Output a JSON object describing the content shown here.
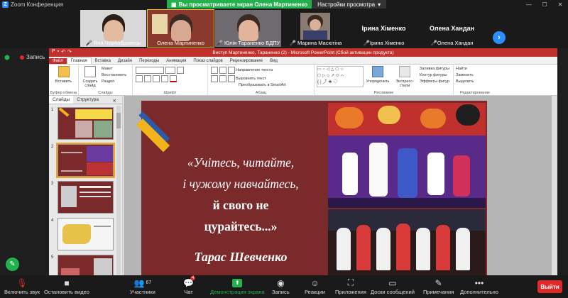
{
  "window": {
    "title": "Zoom Конференция",
    "controls": [
      "—",
      "☐",
      "✕"
    ]
  },
  "viewing": {
    "text": "Вы просматриваете экран Олена Мартиненко",
    "options": "Настройки просмотра",
    "arrow": "▾"
  },
  "participants": [
    {
      "name": "Яна Чорнобривець",
      "muted": true
    },
    {
      "name": "Олена Мартиненко",
      "muted": false
    },
    {
      "name": "Юлія Тараненко БДПУ",
      "muted": true
    },
    {
      "name": "Марина Масютіна",
      "muted": true
    },
    {
      "name": "Ірина Хіменко",
      "muted": true
    },
    {
      "name": "Олена Хандан",
      "muted": true
    }
  ],
  "recording": {
    "label": "Запись"
  },
  "ppt": {
    "title": "Виступ Мартиненко, Тараненко (2) - Microsoft PowerPoint (Сбой активации продукта)",
    "tabs": [
      "Файл",
      "Главная",
      "Вставка",
      "Дизайн",
      "Переходы",
      "Анимация",
      "Показ слайдов",
      "Рецензирование",
      "Вид"
    ],
    "ribbon": {
      "clipboard": "Буфер обмена",
      "slides": "Слайды",
      "font": "Шрифт",
      "paragraph": "Абзац",
      "drawing": "Рисование",
      "editing": "Редактирование",
      "paste": "Вставить",
      "create": "Создать слайд",
      "layout": "Макет",
      "restore": "Восстановить",
      "section": "Раздел",
      "direction": "Направление текста",
      "align": "Выровнять текст",
      "smartart": "Преобразовать в SmartArt",
      "arrange": "Упорядочить",
      "styles": "Экспресс-стили",
      "fill": "Заливка фигуры",
      "outline": "Контур фигуры",
      "effects": "Эффекты фигур",
      "find": "Найти",
      "replace": "Заменить",
      "select": "Выделить"
    },
    "pane_tabs": [
      "Слайды",
      "Структура"
    ],
    "pane_close": "✕",
    "slide_numbers": [
      "1",
      "2",
      "3",
      "4",
      "5"
    ],
    "slide": {
      "quote_lines": [
        "«Учітесь, читайте,",
        "і чужому навчайтесь,",
        "й свого не",
        "цурайтесь...»"
      ],
      "author": "Тарас Шевченко"
    }
  },
  "toolbar": [
    {
      "label": "Включить звук",
      "icon": "mic-muted-icon",
      "glyph": "🎙"
    },
    {
      "label": "Остановить видео",
      "icon": "camera-icon",
      "glyph": "■"
    },
    {
      "label": "Участники",
      "icon": "participants-icon",
      "glyph": "👥",
      "count": "67"
    },
    {
      "label": "Чат",
      "icon": "chat-icon",
      "glyph": "💬",
      "badge": "4"
    },
    {
      "label": "Демонстрация экрана",
      "icon": "share-screen-icon",
      "glyph": "⬆"
    },
    {
      "label": "Запись",
      "icon": "record-icon",
      "glyph": "◉"
    },
    {
      "label": "Реакции",
      "icon": "reactions-icon",
      "glyph": "☺"
    },
    {
      "label": "Приложения",
      "icon": "apps-icon",
      "glyph": "⛶"
    },
    {
      "label": "Доски сообщений",
      "icon": "whiteboard-icon",
      "glyph": "▭"
    },
    {
      "label": "Примечания",
      "icon": "notes-icon",
      "glyph": "✎"
    },
    {
      "label": "Дополнительно",
      "icon": "more-icon",
      "glyph": "•••"
    }
  ],
  "leave_label": "Выйти",
  "colors": {
    "zoom_green": "#23b14d",
    "zoom_blue": "#2d8cff",
    "ppt_red": "#c0302c",
    "slide_bg": "#7a2a2b",
    "muted_red": "#e02828"
  }
}
